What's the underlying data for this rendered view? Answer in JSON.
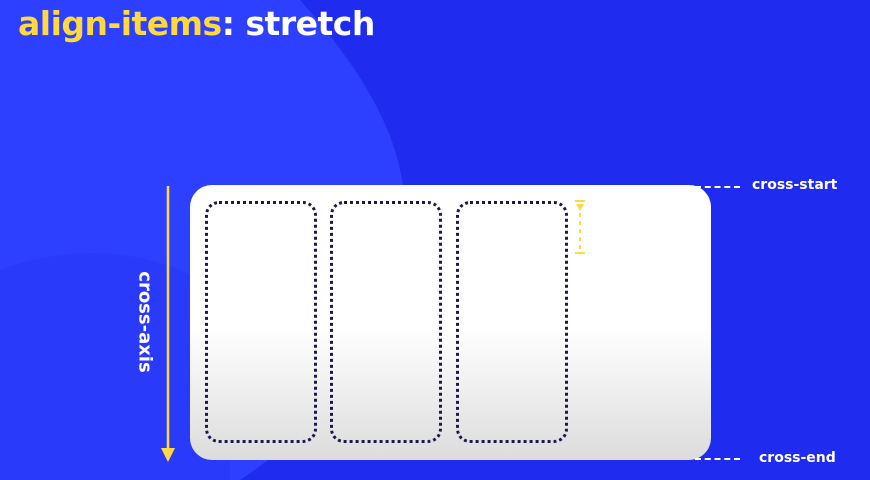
{
  "title": {
    "property": "align-items",
    "separator": ":",
    "value": "stretch"
  },
  "diagram": {
    "axis_label": "cross-axis",
    "start_label": "cross-start",
    "end_label": "cross-end",
    "item_count": 3
  },
  "colors": {
    "background": "#1f2cf0",
    "background_light": "#2d40ff",
    "accent": "#ffd93d",
    "text": "#ffffff",
    "item_border": "#1a1a4a",
    "container": "#ffffff"
  }
}
